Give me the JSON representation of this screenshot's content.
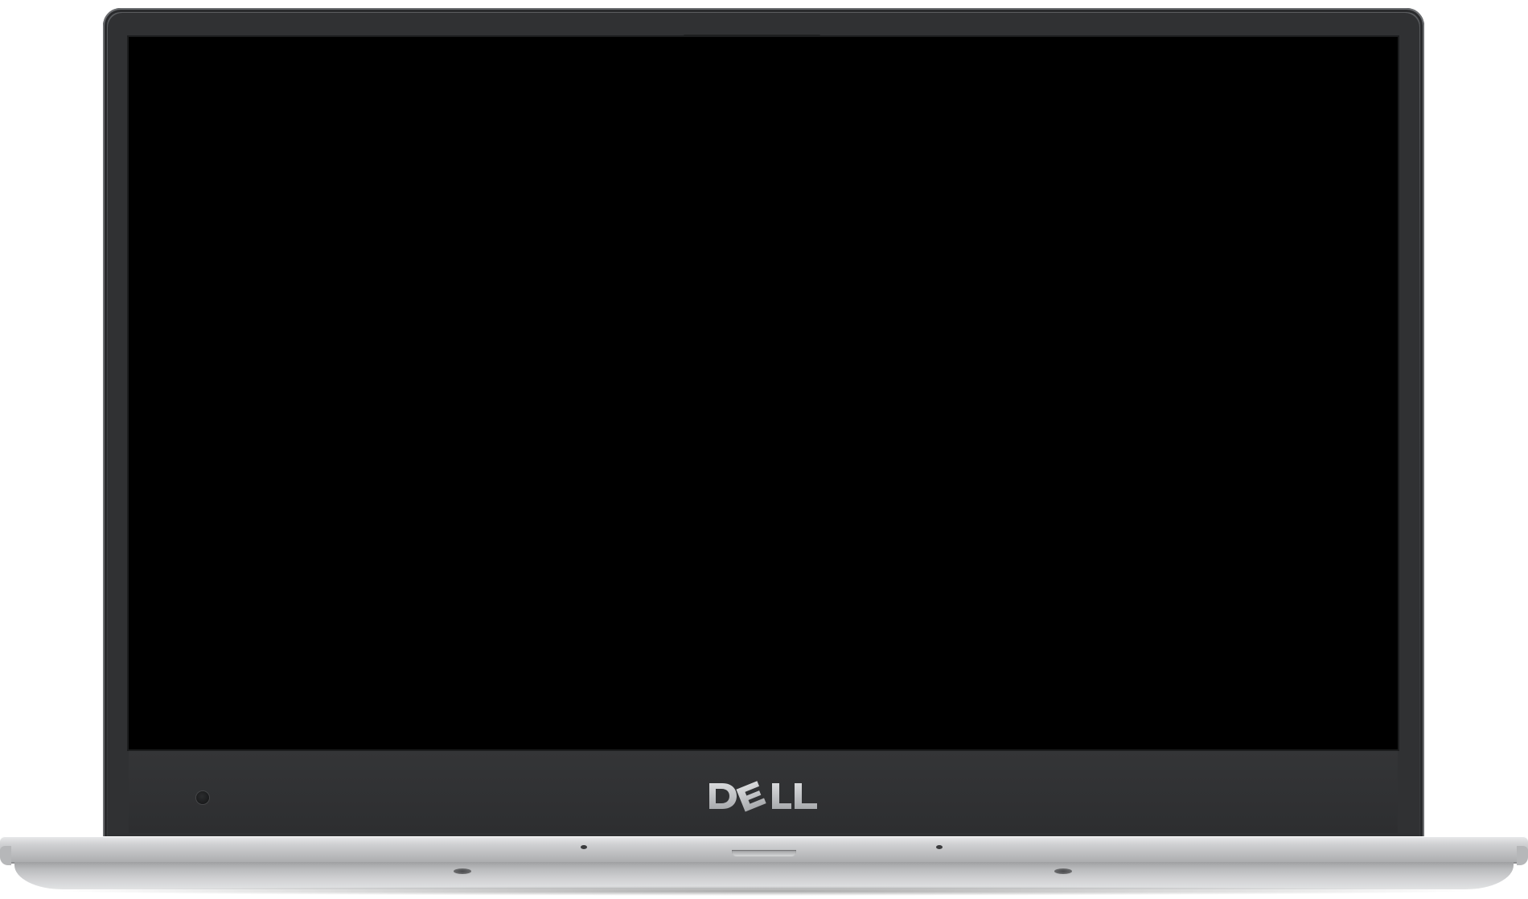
{
  "device": {
    "brand": "DELL",
    "type": "laptop",
    "screen": {
      "state": "off",
      "color": "#000000"
    }
  },
  "icons": {
    "logo": "dell-logo",
    "sensor": "ambient-light-sensor-icon"
  },
  "colors": {
    "bezel": "#303133",
    "screen": "#000000",
    "base": "#cfd0d2",
    "logo": "#bfc1c4"
  }
}
